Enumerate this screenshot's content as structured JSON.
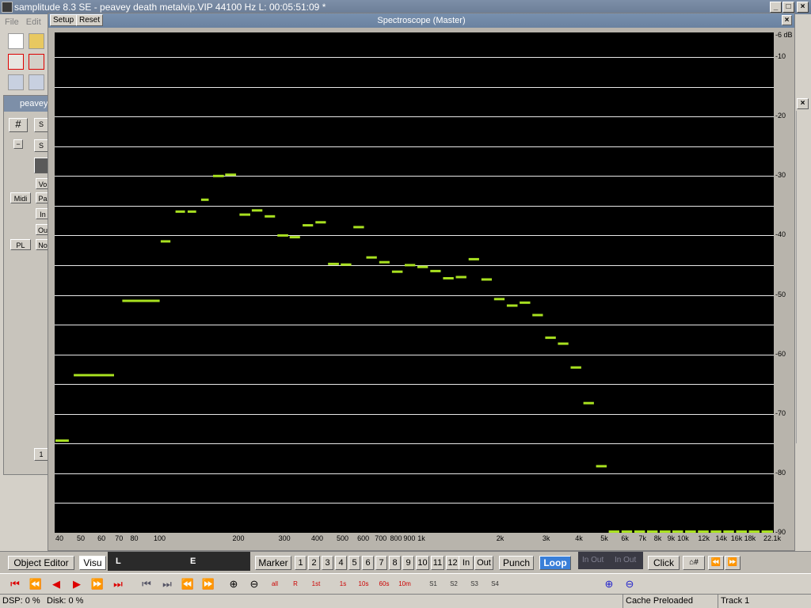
{
  "app": {
    "title": "samplitude 8.3 SE  - peavey death metalvip.VIP   44100 Hz L: 00:05:51:09 *"
  },
  "menu": {
    "file": "File",
    "edit": "Edit"
  },
  "project": {
    "title": "peavey",
    "buttons": {
      "midi": "Midi",
      "pl": "PL",
      "s1": "S",
      "s2": "S",
      "vo": "Vo",
      "pa": "Pa",
      "in": "In",
      "ou": "Ou",
      "no": "No",
      "one": "1"
    }
  },
  "spectroscope": {
    "title": "Spectroscope (Master)",
    "menu_setup": "Setup",
    "menu_reset": "Reset",
    "db_labels": [
      "-6 dB",
      "-10",
      "-20",
      "-30",
      "-40",
      "-50",
      "-60",
      "-70",
      "-80",
      "-90"
    ],
    "hz_labels": [
      "40",
      "50",
      "60",
      "70",
      "80",
      "100",
      "200",
      "300",
      "400",
      "500",
      "600",
      "700",
      "800",
      "900",
      "1k",
      "2k",
      "3k",
      "4k",
      "5k",
      "6k",
      "7k",
      "8k",
      "9k",
      "10k",
      "12k",
      "14k",
      "16k",
      "18k",
      "22.1k"
    ]
  },
  "chart_data": {
    "type": "bar",
    "xlabel": "",
    "ylabel": "",
    "x_scale": "log",
    "ylim": [
      -90,
      -6
    ],
    "grid": true,
    "x_ticks": [
      "40",
      "50",
      "60",
      "70",
      "80",
      "100",
      "200",
      "300",
      "400",
      "500",
      "600",
      "700",
      "800",
      "900",
      "1k",
      "2k",
      "3k",
      "4k",
      "5k",
      "6k",
      "7k",
      "8k",
      "9k",
      "10k",
      "12k",
      "14k",
      "16k",
      "18k",
      "22.1k"
    ],
    "y_ticks": [
      "-6 dB",
      "-10",
      "-20",
      "-30",
      "-40",
      "-50",
      "-60",
      "-70",
      "-80",
      "-90"
    ],
    "bands": [
      {
        "f_lo": 40,
        "f_hi": 45,
        "db": -74.5
      },
      {
        "f_lo": 47,
        "f_hi": 67,
        "db": -63.5
      },
      {
        "f_lo": 72,
        "f_hi": 100,
        "db": -51
      },
      {
        "f_lo": 101,
        "f_hi": 110,
        "db": -41
      },
      {
        "f_lo": 115,
        "f_hi": 125,
        "db": -36
      },
      {
        "f_lo": 128,
        "f_hi": 138,
        "db": -36
      },
      {
        "f_lo": 144,
        "f_hi": 154,
        "db": -34
      },
      {
        "f_lo": 160,
        "f_hi": 176,
        "db": -30
      },
      {
        "f_lo": 178,
        "f_hi": 196,
        "db": -29.8
      },
      {
        "f_lo": 202,
        "f_hi": 222,
        "db": -36.5
      },
      {
        "f_lo": 225,
        "f_hi": 247,
        "db": -35.8
      },
      {
        "f_lo": 252,
        "f_hi": 276,
        "db": -36.8
      },
      {
        "f_lo": 282,
        "f_hi": 310,
        "db": -40
      },
      {
        "f_lo": 314,
        "f_hi": 344,
        "db": -40.3
      },
      {
        "f_lo": 352,
        "f_hi": 386,
        "db": -38.3
      },
      {
        "f_lo": 394,
        "f_hi": 432,
        "db": -37.8
      },
      {
        "f_lo": 440,
        "f_hi": 484,
        "db": -44.8
      },
      {
        "f_lo": 492,
        "f_hi": 540,
        "db": -44.9
      },
      {
        "f_lo": 550,
        "f_hi": 604,
        "db": -38.6
      },
      {
        "f_lo": 616,
        "f_hi": 676,
        "db": -43.7
      },
      {
        "f_lo": 690,
        "f_hi": 756,
        "db": -44.5
      },
      {
        "f_lo": 772,
        "f_hi": 848,
        "db": -46.1
      },
      {
        "f_lo": 864,
        "f_hi": 948,
        "db": -45
      },
      {
        "f_lo": 966,
        "f_hi": 1060,
        "db": -45.3
      },
      {
        "f_lo": 1082,
        "f_hi": 1186,
        "db": -46
      },
      {
        "f_lo": 1210,
        "f_hi": 1328,
        "db": -47.2
      },
      {
        "f_lo": 1354,
        "f_hi": 1486,
        "db": -47
      },
      {
        "f_lo": 1516,
        "f_hi": 1662,
        "db": -44
      },
      {
        "f_lo": 1696,
        "f_hi": 1860,
        "db": -47.4
      },
      {
        "f_lo": 1896,
        "f_hi": 2080,
        "db": -50.7
      },
      {
        "f_lo": 2120,
        "f_hi": 2330,
        "db": -51.8
      },
      {
        "f_lo": 2374,
        "f_hi": 2606,
        "db": -51.3
      },
      {
        "f_lo": 2656,
        "f_hi": 2914,
        "db": -53.4
      },
      {
        "f_lo": 2972,
        "f_hi": 3262,
        "db": -57.2
      },
      {
        "f_lo": 3324,
        "f_hi": 3648,
        "db": -58.2
      },
      {
        "f_lo": 3718,
        "f_hi": 4082,
        "db": -62.2
      },
      {
        "f_lo": 4160,
        "f_hi": 4564,
        "db": -68.2
      },
      {
        "f_lo": 4650,
        "f_hi": 5106,
        "db": -78.8
      },
      {
        "f_lo": 5200,
        "f_hi": 5710,
        "db": -89.8
      },
      {
        "f_lo": 5820,
        "f_hi": 6390,
        "db": -89.8
      },
      {
        "f_lo": 6510,
        "f_hi": 7150,
        "db": -89.8
      },
      {
        "f_lo": 7280,
        "f_hi": 8000,
        "db": -89.8
      },
      {
        "f_lo": 8140,
        "f_hi": 8950,
        "db": -89.8
      },
      {
        "f_lo": 9100,
        "f_hi": 10000,
        "db": -89.8
      },
      {
        "f_lo": 10180,
        "f_hi": 11190,
        "db": -89.8
      },
      {
        "f_lo": 11390,
        "f_hi": 12520,
        "db": -89.8
      },
      {
        "f_lo": 12740,
        "f_hi": 14000,
        "db": -89.8
      },
      {
        "f_lo": 14250,
        "f_hi": 15660,
        "db": -89.8
      },
      {
        "f_lo": 15940,
        "f_hi": 17520,
        "db": -89.8
      },
      {
        "f_lo": 17830,
        "f_hi": 19600,
        "db": -89.8
      },
      {
        "f_lo": 19950,
        "f_hi": 22050,
        "db": -89.8
      }
    ]
  },
  "transport": {
    "object_editor": "Object Editor",
    "visual": "Visu",
    "lcd_left": "L",
    "lcd_right": "E",
    "marker": "Marker",
    "marker_numbers": [
      "1",
      "2",
      "3",
      "4",
      "5",
      "6",
      "7",
      "8",
      "9",
      "10",
      "11",
      "12"
    ],
    "in": "In",
    "out": "Out",
    "punch": "Punch",
    "loop": "Loop",
    "dark_in_out_1": "In Out",
    "dark_in_out_2": "In Out",
    "click": "Click",
    "hash": "⌂#",
    "rewind": "⏪",
    "forward": "⏩"
  },
  "toolbar2": {
    "zoom_labels": [
      "all",
      "R",
      "1st",
      "1s",
      "10s",
      "60s",
      "10m",
      "S1",
      "S2",
      "S3",
      "S4"
    ]
  },
  "status": {
    "dsp": "DSP: 0 %",
    "disk": "Disk: 0 %",
    "cache": "Cache Preloaded",
    "track": "Track 1"
  },
  "colors": {
    "bar": "#a8e020",
    "plot_bg": "#000000",
    "grid": "#e8e8e8",
    "accent": "#d00000",
    "loop_active": "#3a7fd8"
  }
}
